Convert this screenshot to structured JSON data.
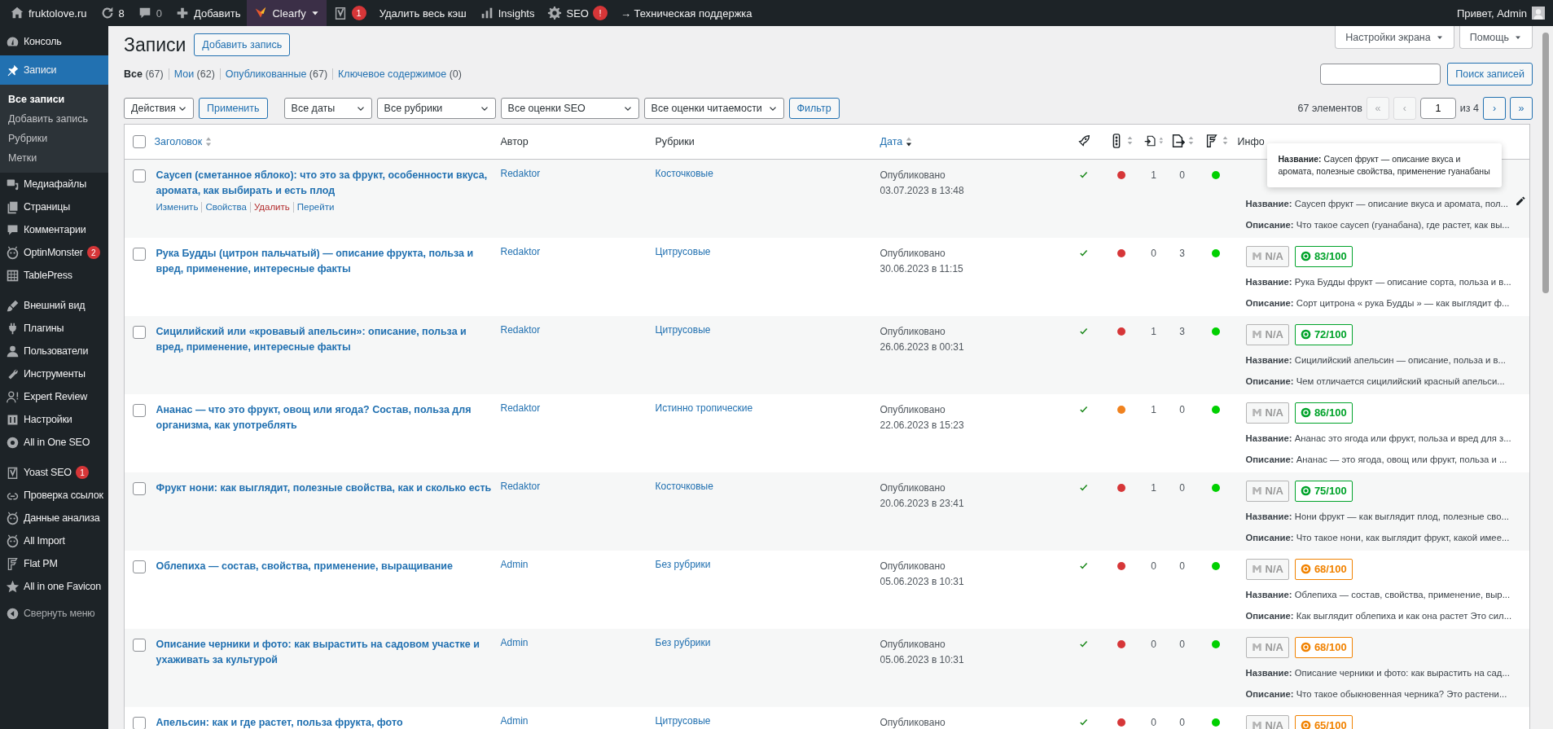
{
  "admin_bar": {
    "items": [
      {
        "kind": "site",
        "label": "fruktolove.ru"
      },
      {
        "kind": "updates",
        "label": "8"
      },
      {
        "kind": "comments",
        "label": "0"
      },
      {
        "kind": "new",
        "label": "Добавить"
      },
      {
        "kind": "clearfy",
        "label": "Clearfy"
      },
      {
        "kind": "yoast",
        "badge": "1"
      },
      {
        "kind": "link",
        "label": "Удалить весь кэш"
      },
      {
        "kind": "insights",
        "label": "Insights"
      },
      {
        "kind": "seo",
        "label": "SEO",
        "badge": "!"
      },
      {
        "kind": "link",
        "label": "→ Техническая поддержка"
      }
    ],
    "account": {
      "greeting": "Привет, Admin"
    }
  },
  "sidebar": {
    "groups": [
      {
        "items": [
          {
            "label": "Консоль",
            "selected": false
          },
          {
            "label": "Записи",
            "selected": true,
            "children": [
              {
                "label": "Все записи",
                "selected": true
              },
              {
                "label": "Добавить запись",
                "selected": false
              },
              {
                "label": "Рубрики",
                "selected": false
              },
              {
                "label": "Метки",
                "selected": false
              }
            ]
          },
          {
            "label": "Медиафайлы",
            "selected": false
          },
          {
            "label": "Страницы",
            "selected": false
          },
          {
            "label": "Комментарии",
            "selected": false
          },
          {
            "label": "OptinMonster",
            "selected": false,
            "badge": "2"
          },
          {
            "label": "TablePress",
            "selected": false
          }
        ]
      },
      {
        "items": [
          {
            "label": "Внешний вид",
            "selected": false
          },
          {
            "label": "Плагины",
            "selected": false
          },
          {
            "label": "Пользователи",
            "selected": false
          },
          {
            "label": "Инструменты",
            "selected": false
          },
          {
            "label": "Expert Review",
            "selected": false
          },
          {
            "label": "Настройки",
            "selected": false
          },
          {
            "label": "All in One SEO",
            "selected": false
          }
        ]
      },
      {
        "items": [
          {
            "label": "Yoast SEO",
            "selected": false,
            "badge": "1"
          },
          {
            "label": "Проверка ссылок",
            "selected": false
          },
          {
            "label": "Данные анализа",
            "selected": false
          },
          {
            "label": "All Import",
            "selected": false
          },
          {
            "label": "Flat PM",
            "selected": false
          },
          {
            "label": "All in one Favicon",
            "selected": false
          }
        ]
      }
    ],
    "collapse": "Свернуть меню"
  },
  "screen_buttons": [
    "Настройки экрана",
    "Помощь"
  ],
  "page": {
    "title": "Записи",
    "add_button": "Добавить запись"
  },
  "status_links": [
    {
      "label": "Все",
      "count": "(67)",
      "selected": true
    },
    {
      "label": "Мои",
      "count": "(62)",
      "selected": false
    },
    {
      "label": "Опубликованные",
      "count": "(67)",
      "selected": false
    },
    {
      "label": "Ключевое содержимое",
      "count": "(0)",
      "selected": false
    }
  ],
  "search": {
    "button": "Поиск записей"
  },
  "bulk": {
    "select": "Действия",
    "button": "Применить"
  },
  "filters": {
    "selects": [
      "Все даты",
      "Все рубрики",
      "Все оценки SEO",
      "Все оценки читаемости"
    ],
    "button": "Фильтр"
  },
  "pagination": {
    "count": "67 элементов",
    "first": "«",
    "prev": "‹",
    "page": "1",
    "of": "из 4",
    "next": "›",
    "last": "»",
    "first_disabled": true,
    "prev_disabled": true
  },
  "table": {
    "select_all_checked": false,
    "columns": [
      {
        "label": "Заголовок",
        "sortable": true,
        "sorted": false
      },
      {
        "label": "Автор",
        "sortable": false
      },
      {
        "label": "Рубрики",
        "sortable": false
      },
      {
        "label": "Дата",
        "sortable": true,
        "sorted": true
      }
    ],
    "icon_columns": [
      {
        "sortable": false
      },
      {
        "sortable": true
      },
      {
        "sortable": true
      },
      {
        "sortable": true
      },
      {
        "sortable": true
      }
    ],
    "info_column": "Инфо",
    "rows": [
      {
        "checked": false,
        "hovered": true,
        "title": "Саусеп (сметанное яблоко): что это за фрукт, особенности вкуса, аромата, как выбирать и есть плод",
        "actions": [
          {
            "label": "Изменить",
            "kind": "link"
          },
          {
            "label": "Свойства",
            "kind": "link"
          },
          {
            "label": "Удалить",
            "kind": "danger"
          },
          {
            "label": "Перейти",
            "kind": "link"
          }
        ],
        "author": "Redaktor",
        "category": "Косточковые",
        "status": "Опубликовано",
        "date": "03.07.2023 в 13:48",
        "passed": true,
        "status_dot": {
          "color": "#d63638"
        },
        "inbound": "1",
        "outbound": "0",
        "flag_dot": {
          "color": "#00d000"
        },
        "tooltip": "**Название:** Саусеп фрукт — описание вкуса и аромата, полезные свойства, применение гуанабаны",
        "seo_title": "**Название:** Саусеп фрукт — описание вкуса и аромата, пол...",
        "seo_description": "**Описание:** Что такое саусеп (гуанабана), где растет, как вы..."
      },
      {
        "checked": false,
        "hovered": false,
        "title": "Рука Будды (цитрон пальчатый) — описание фрукта, польза и вред, применение, интересные факты",
        "author": "Redaktor",
        "category": "Цитрусовые",
        "status": "Опубликовано",
        "date": "30.06.2023 в 11:15",
        "passed": true,
        "status_dot": {
          "color": "#d63638"
        },
        "inbound": "0",
        "outbound": "3",
        "flag_dot": {
          "color": "#00d000"
        },
        "na": "N/A",
        "score": {
          "text": "83/100",
          "color": "#00a32a"
        },
        "seo_title": "**Название:** Рука Будды фрукт — описание сорта, польза и в...",
        "seo_description": "**Описание:** Сорт цитрона « рука Будды » — как выглядит ф..."
      },
      {
        "checked": false,
        "hovered": false,
        "title": "Сицилийский или «кровавый апельсин»: описание, польза и вред, применение, интересные факты",
        "author": "Redaktor",
        "category": "Цитрусовые",
        "status": "Опубликовано",
        "date": "26.06.2023 в 00:31",
        "passed": true,
        "status_dot": {
          "color": "#d63638"
        },
        "inbound": "1",
        "outbound": "3",
        "flag_dot": {
          "color": "#00d000"
        },
        "na": "N/A",
        "score": {
          "text": "72/100",
          "color": "#00a32a"
        },
        "seo_title": "**Название:** Сицилийский апельсин — описание, польза и в...",
        "seo_description": "**Описание:** Чем отличается сицилийский красный апельси..."
      },
      {
        "checked": false,
        "hovered": false,
        "title": "Ананас — что это фрукт, овощ или ягода? Состав, польза для организма, как употреблять",
        "author": "Redaktor",
        "category": "Истинно тропические",
        "status": "Опубликовано",
        "date": "22.06.2023 в 15:23",
        "passed": true,
        "status_dot": {
          "color": "#f0821e"
        },
        "inbound": "1",
        "outbound": "0",
        "flag_dot": {
          "color": "#00d000"
        },
        "na": "N/A",
        "score": {
          "text": "86/100",
          "color": "#00a32a"
        },
        "seo_title": "**Название:** Ананас это ягода или фрукт, польза и вред для з...",
        "seo_description": "**Описание:** Ананас — это ягода, овощ или фрукт, польза и ..."
      },
      {
        "checked": false,
        "hovered": false,
        "title": "Фрукт нони: как выглядит, полезные свойства, как и сколько есть",
        "author": "Redaktor",
        "category": "Косточковые",
        "status": "Опубликовано",
        "date": "20.06.2023 в 23:41",
        "passed": true,
        "status_dot": {
          "color": "#d63638"
        },
        "inbound": "1",
        "outbound": "0",
        "flag_dot": {
          "color": "#00d000"
        },
        "na": "N/A",
        "score": {
          "text": "75/100",
          "color": "#00a32a"
        },
        "seo_title": "**Название:** Нони фрукт — как выглядит плод, полезные сво...",
        "seo_description": "**Описание:** Что такое нони, как выглядит фрукт, какой имее..."
      },
      {
        "checked": false,
        "hovered": false,
        "title": "Облепиха — состав, свойства, применение, выращивание",
        "author": "Admin",
        "category": "Без рубрики",
        "status": "Опубликовано",
        "date": "05.06.2023 в 10:31",
        "passed": true,
        "status_dot": {
          "color": "#d63638"
        },
        "inbound": "0",
        "outbound": "0",
        "flag_dot": {
          "color": "#00d000"
        },
        "na": "N/A",
        "score": {
          "text": "68/100",
          "color": "#f18200"
        },
        "seo_title": "**Название:** Облепиха — состав, свойства, применение, выр...",
        "seo_description": "**Описание:** Как выглядит облепиха и как она растет Это сил..."
      },
      {
        "checked": false,
        "hovered": false,
        "title": "Описание черники и фото: как вырастить на садовом участке и ухаживать за культурой",
        "author": "Admin",
        "category": "Без рубрики",
        "status": "Опубликовано",
        "date": "05.06.2023 в 10:31",
        "passed": true,
        "status_dot": {
          "color": "#d63638"
        },
        "inbound": "0",
        "outbound": "0",
        "flag_dot": {
          "color": "#00d000"
        },
        "na": "N/A",
        "score": {
          "text": "68/100",
          "color": "#f18200"
        },
        "seo_title": "**Название:** Описание черники и фото: как вырастить на сад...",
        "seo_description": "**Описание:** Что такое обыкновенная черника? Это растени..."
      },
      {
        "checked": false,
        "hovered": false,
        "title": "Апельсин: как и где растет, польза фрукта, фото",
        "author": "Admin",
        "category": "Цитрусовые",
        "status": "Опубликовано",
        "passed": true,
        "status_dot": {
          "color": "#d63638"
        },
        "inbound": "0",
        "outbound": "0",
        "flag_dot": {
          "color": "#00d000"
        },
        "na": "N/A",
        "score": {
          "text": "65/100",
          "color": "#f18200"
        }
      }
    ]
  }
}
